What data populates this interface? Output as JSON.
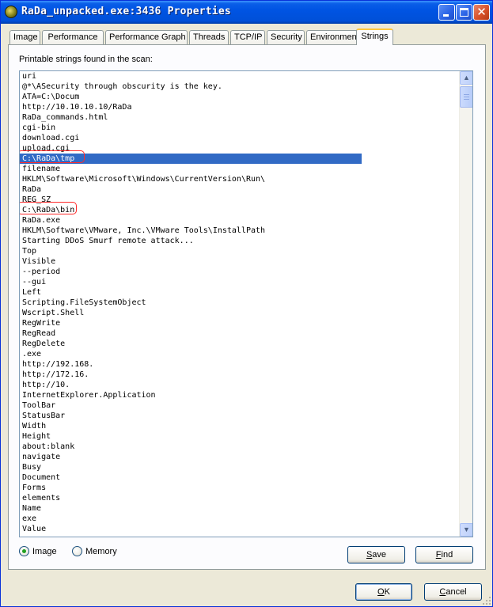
{
  "window": {
    "title": "RaDa_unpacked.exe:3436 Properties",
    "colors": {
      "title_bar": "#0054e3",
      "selection": "#316ac5",
      "annotation_circle": "#ff2a2a",
      "panel": "#fcfcfe",
      "window_bg": "#ece9d8"
    }
  },
  "tabs": [
    {
      "label": "Image"
    },
    {
      "label": "Performance"
    },
    {
      "label": "Performance Graph"
    },
    {
      "label": "Threads"
    },
    {
      "label": "TCP/IP"
    },
    {
      "label": "Security"
    },
    {
      "label": "Environment"
    },
    {
      "label": "Strings",
      "active": true
    }
  ],
  "strings_panel": {
    "label": "Printable strings found in the scan:",
    "selected_index": 8,
    "circled_indices": [
      8,
      13
    ],
    "strings": [
      "uri",
      "@*\\ASecurity through obscurity is the key.",
      "ATA=C:\\Docum",
      "http://10.10.10.10/RaDa",
      "RaDa_commands.html",
      "cgi-bin",
      "download.cgi",
      "upload.cgi",
      "C:\\RaDa\\tmp",
      "filename",
      "HKLM\\Software\\Microsoft\\Windows\\CurrentVersion\\Run\\",
      "RaDa",
      "REG_SZ",
      "C:\\RaDa\\bin",
      "RaDa.exe",
      "HKLM\\Software\\VMware, Inc.\\VMware Tools\\InstallPath",
      "Starting DDoS Smurf remote attack...",
      "Top",
      "Visible",
      "--period",
      "--gui",
      "Left",
      "Scripting.FileSystemObject",
      "Wscript.Shell",
      "RegWrite",
      "RegRead",
      "RegDelete",
      ".exe",
      "http://192.168.",
      "http://172.16.",
      "http://10.",
      "InternetExplorer.Application",
      "ToolBar",
      "StatusBar",
      "Width",
      "Height",
      "about:blank",
      "navigate",
      "Busy",
      "Document",
      "Forms",
      "elements",
      "Name",
      "exe",
      "Value"
    ]
  },
  "source_options": {
    "image_label": "Image",
    "memory_label": "Memory",
    "selected": "Image"
  },
  "buttons": {
    "save": {
      "prefix": "",
      "mnemonic": "S",
      "rest": "ave"
    },
    "find": {
      "prefix": "",
      "mnemonic": "F",
      "rest": "ind"
    },
    "ok": {
      "prefix": "",
      "mnemonic": "O",
      "rest": "K"
    },
    "cancel": {
      "prefix": "",
      "mnemonic": "C",
      "rest": "ancel"
    }
  }
}
